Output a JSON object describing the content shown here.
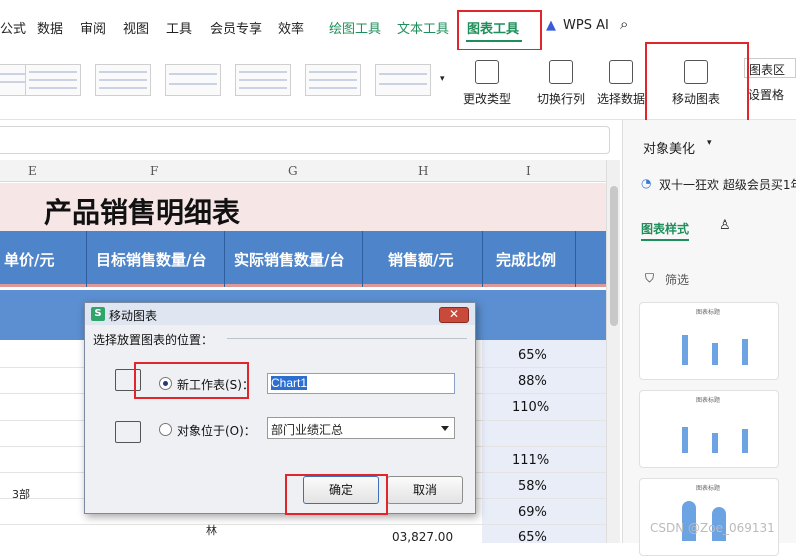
{
  "menu": {
    "tabs": [
      "公式",
      "数据",
      "审阅",
      "视图",
      "工具",
      "会员专享",
      "效率"
    ],
    "green_tabs": [
      "绘图工具",
      "文本工具"
    ],
    "selected_tab": "图表工具",
    "wps_ai": "WPS AI"
  },
  "ribbon": {
    "change_type": "更改类型",
    "switch_row_col": "切换行列",
    "select_data": "选择数据",
    "move_chart": "移动图表",
    "chart_area": "图表区",
    "settings": "设置格"
  },
  "sheet": {
    "columns": [
      "E",
      "F",
      "G",
      "H",
      "I"
    ],
    "title": "产品销售明细表",
    "headers": [
      "单价/元",
      "目标销售数量/台",
      "实际销售数量/台",
      "销售额/元",
      "完成比例"
    ],
    "percents": [
      "65%",
      "88%",
      "110%",
      "111%",
      "58%",
      "69%",
      "65%"
    ],
    "partial_value": "03,827.00",
    "left_fragment": "3部",
    "bottom_fragment": "林"
  },
  "panel": {
    "object_beautify": "对象美化",
    "promo": "双十一狂欢 超级会员买1年",
    "tab_chart_style": "图表样式",
    "filter": "筛选",
    "card_title": "图表标题"
  },
  "dialog": {
    "title": "移动图表",
    "logo": "S",
    "prompt": "选择放置图表的位置：",
    "new_sheet_label": "新工作表(S)：",
    "new_sheet_value": "Chart1",
    "object_in_label": "对象位于(O)：",
    "object_in_value": "部门业绩汇总",
    "ok": "确定",
    "cancel": "取消",
    "close": "✕"
  },
  "watermark": "CSDN @Zoe_069131",
  "colors": {
    "accent": "#1e8f5a",
    "header_blue": "#4e84c9",
    "highlight_red": "#e2252b"
  }
}
